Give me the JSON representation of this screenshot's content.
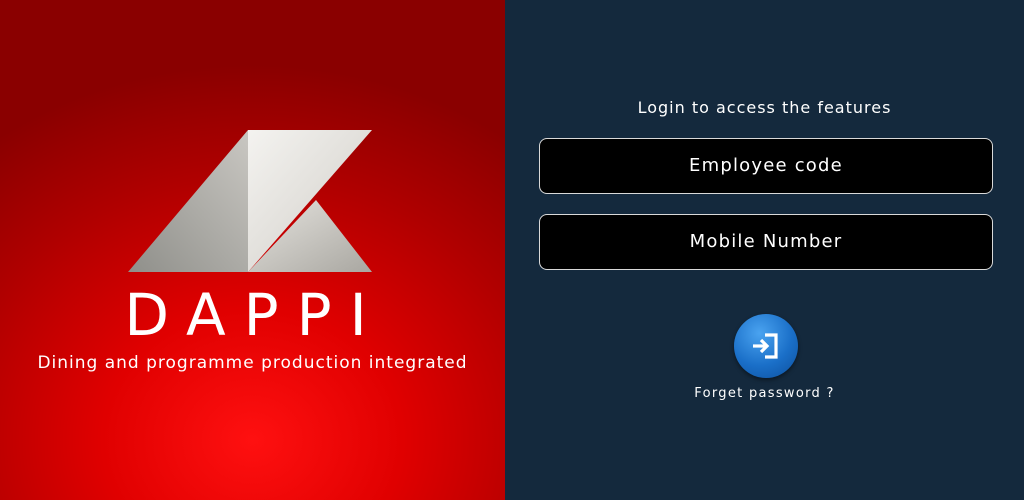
{
  "brand": {
    "name": "DAPPI",
    "tagline": "Dining and programme production integrated",
    "logo_icon": "dappi-k-logo-mark"
  },
  "login": {
    "heading": "Login to access the features",
    "employee_code": {
      "value": "",
      "placeholder": "Employee code"
    },
    "mobile_number": {
      "value": "",
      "placeholder": "Mobile Number"
    },
    "submit_icon": "login-enter-icon",
    "forget_password": "Forget password ?"
  },
  "colors": {
    "left_panel_red": "#e00000",
    "right_panel_navy": "#14293d",
    "field_background": "#000000",
    "login_button_blue": "#1a6fc8",
    "text": "#ffffff"
  }
}
